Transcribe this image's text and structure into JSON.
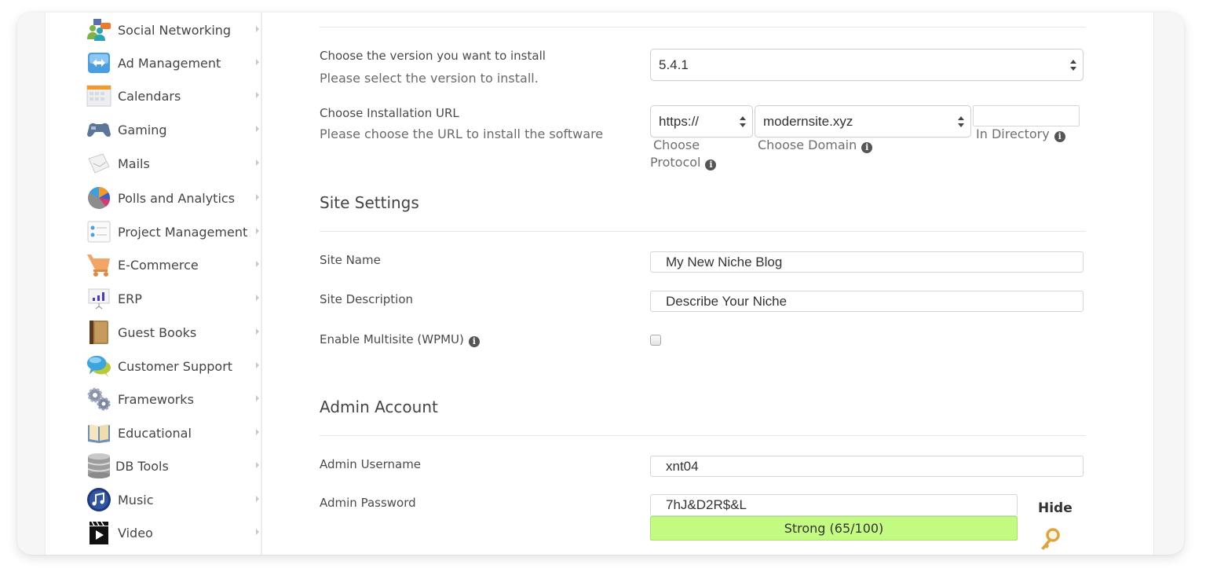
{
  "sidebar": {
    "items": [
      {
        "label": "Social Networking",
        "icon": "social-networking-icon"
      },
      {
        "label": "Ad Management",
        "icon": "ad-management-icon"
      },
      {
        "label": "Calendars",
        "icon": "calendar-icon"
      },
      {
        "label": "Gaming",
        "icon": "gamepad-icon"
      },
      {
        "label": "Mails",
        "icon": "mail-icon"
      },
      {
        "label": "Polls and Analytics",
        "icon": "pie-chart-icon"
      },
      {
        "label": "Project Management",
        "icon": "checklist-icon"
      },
      {
        "label": "E-Commerce",
        "icon": "shopping-cart-icon"
      },
      {
        "label": "ERP",
        "icon": "bar-chart-board-icon"
      },
      {
        "label": "Guest Books",
        "icon": "book-icon"
      },
      {
        "label": "Customer Support",
        "icon": "chat-bubbles-icon"
      },
      {
        "label": "Frameworks",
        "icon": "gears-icon"
      },
      {
        "label": "Educational",
        "icon": "open-book-icon"
      },
      {
        "label": "DB Tools",
        "icon": "database-icon"
      },
      {
        "label": "Music",
        "icon": "music-note-icon"
      },
      {
        "label": "Video",
        "icon": "clapperboard-icon"
      }
    ]
  },
  "software_setup": {
    "version": {
      "label": "Choose the version you want to install",
      "help": "Please select the version to install.",
      "value": "5.4.1"
    },
    "install_url": {
      "label": "Choose Installation URL",
      "help": "Please choose the URL to install the software",
      "protocol": {
        "value": "https://",
        "caption_line1": "Choose",
        "caption_line2": "Protocol"
      },
      "domain": {
        "value": "modernsite.xyz",
        "caption": "Choose Domain"
      },
      "directory": {
        "value": "",
        "caption": "In Directory"
      }
    }
  },
  "site_settings": {
    "title": "Site Settings",
    "site_name": {
      "label": "Site Name",
      "value": "My New Niche Blog"
    },
    "site_description": {
      "label": "Site Description",
      "value": "Describe Your Niche"
    },
    "multisite": {
      "label": "Enable Multisite (WPMU)",
      "checked": false
    }
  },
  "admin_account": {
    "title": "Admin Account",
    "username": {
      "label": "Admin Username",
      "value": "xnt04"
    },
    "password": {
      "label": "Admin Password",
      "value": "7hJ&D2R$&L",
      "strength_text": "Strong (65/100)",
      "strength_score": 65,
      "strength_max": 100,
      "hide_label": "Hide"
    }
  },
  "colors": {
    "strength_fill": "#c3fb82",
    "key_icon": "#e0a43a"
  }
}
